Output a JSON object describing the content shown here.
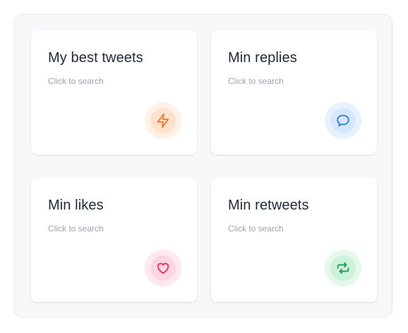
{
  "cards": [
    {
      "title": "My best tweets",
      "subtitle": "Click to search",
      "icon": "bolt-icon",
      "icon_color": "#ea7a2f",
      "halo_color": "#fff1e7",
      "inner_color": "#ffe2cc"
    },
    {
      "title": "Min replies",
      "subtitle": "Click to search",
      "icon": "speech-bubble-icon",
      "icon_color": "#2f7ee3",
      "halo_color": "#e8f2ff",
      "inner_color": "#d4e7ff"
    },
    {
      "title": "Min likes",
      "subtitle": "Click to search",
      "icon": "heart-icon",
      "icon_color": "#dd2f62",
      "halo_color": "#ffe9ef",
      "inner_color": "#ffd6e1"
    },
    {
      "title": "Min retweets",
      "subtitle": "Click to search",
      "icon": "retweet-icon",
      "icon_color": "#1f9d55",
      "halo_color": "#e6f8ee",
      "inner_color": "#ccf1dd"
    }
  ]
}
